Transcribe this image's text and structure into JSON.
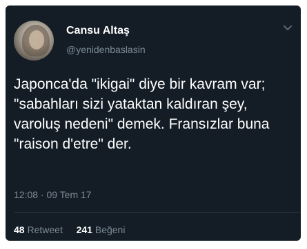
{
  "tweet": {
    "author": {
      "display_name": "Cansu Altaş",
      "handle": "@yenidenbaslasin"
    },
    "text": "Japonca'da \"ikigai\" diye bir kavram var; \"sabahları sizi yataktan kaldıran şey, varoluş nedeni\" demek. Fransızlar buna \"raison d'etre\" der.",
    "timestamp": "12:08 · 09 Tem 17",
    "stats": {
      "retweet_count": "48",
      "retweet_label": "Retweet",
      "like_count": "241",
      "like_label": "Beğeni"
    },
    "menu_icon": "chevron-down-icon"
  },
  "colors": {
    "background": "#141d26",
    "text_primary": "#ffffff",
    "text_secondary": "#7c8a96"
  }
}
